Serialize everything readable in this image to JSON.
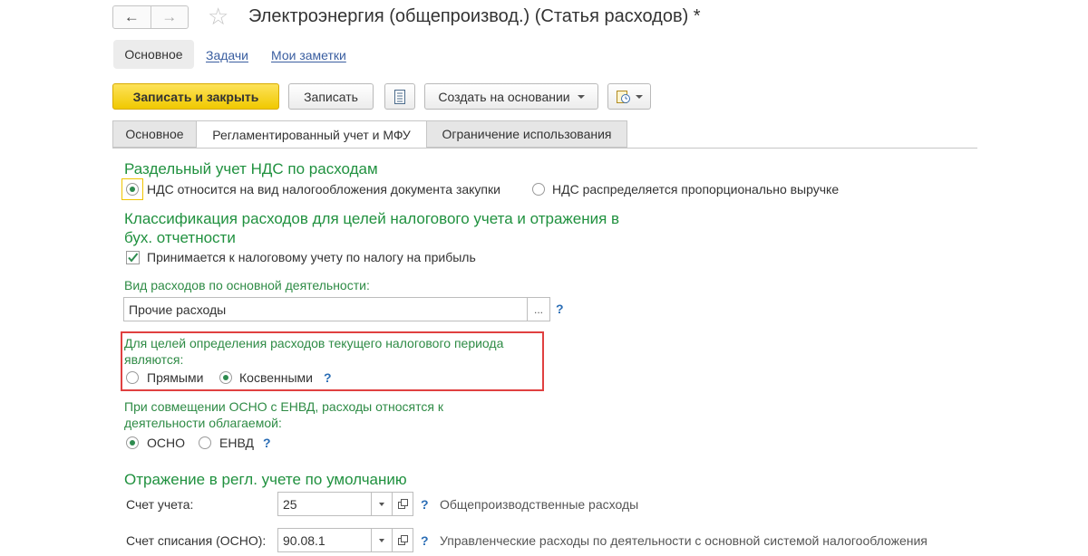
{
  "header": {
    "back_glyph": "←",
    "forward_glyph": "→",
    "star_glyph": "☆",
    "title": "Электроэнергия (общепроизвод.) (Статья расходов) *"
  },
  "top_tabs": {
    "main": "Основное",
    "tasks": "Задачи",
    "notes": "Мои заметки"
  },
  "toolbar": {
    "save_close": "Записать и закрыть",
    "save": "Записать",
    "create_based": "Создать на основании",
    "icons": [
      "report-icon",
      "clock-menu-icon"
    ]
  },
  "form_tabs": {
    "main": "Основное",
    "regulated": "Регламентированный учет и МФУ",
    "restriction": "Ограничение использования"
  },
  "vat": {
    "section": "Раздельный учет НДС по расходам",
    "option1": "НДС относится на вид налогообложения документа закупки",
    "option2": "НДС распределяется пропорционально выручке",
    "selected": 1
  },
  "classification": {
    "section_line1": "Классификация расходов для целей налогового учета и отражения в",
    "section_line2": "бух. отчетности",
    "checkbox_label": "Принимается к налоговому учету по налогу на прибыль",
    "checked": true,
    "expense_type_label": "Вид расходов по основной деятельности:",
    "expense_type_value": "Прочие расходы",
    "ellipsis": "...",
    "help": "?"
  },
  "period": {
    "label_line1": "Для целей определения расходов текущего налогового периода",
    "label_line2": "являются:",
    "option1": "Прямыми",
    "option2": "Косвенными",
    "selected": 2,
    "help": "?"
  },
  "osno_envd": {
    "label_line1": "При совмещении ОСНО с ЕНВД, расходы относятся к",
    "label_line2": "деятельности облагаемой:",
    "option1": "ОСНО",
    "option2": "ЕНВД",
    "selected": 1,
    "help": "?"
  },
  "regl": {
    "section": "Отражение в регл. учете по умолчанию",
    "account_label": "Счет учета:",
    "account_value": "25",
    "account_desc": "Общепроизводственные расходы",
    "writeoff_label": "Счет списания (ОСНО):",
    "writeoff_value": "90.08.1",
    "writeoff_desc": "Управленческие расходы по деятельности с основной системой налогообложения",
    "help": "?"
  },
  "colors": {
    "accent_green": "#20913f",
    "primary_yellow": "#f0c900",
    "highlight_red": "#e04040",
    "link_blue": "#3a5ea0"
  }
}
